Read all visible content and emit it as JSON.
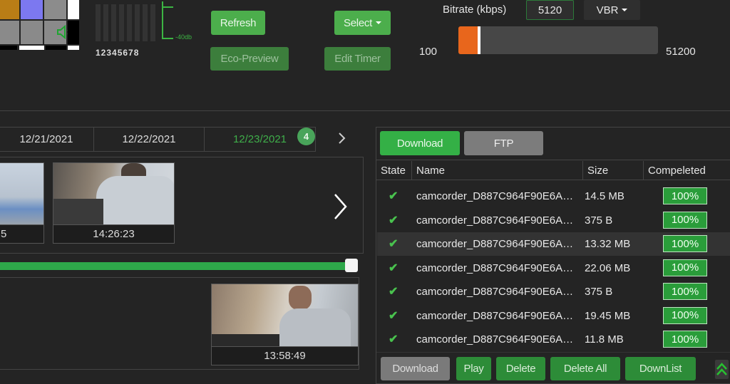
{
  "audio_meter": {
    "channels": "12345678",
    "db_label": "-40db",
    "mute_icon": "speaker-mute-icon"
  },
  "toolbar": {
    "refresh_label": "Refresh",
    "select_label": "Select",
    "eco_preview_label": "Eco-Preview",
    "edit_timer_label": "Edit Timer"
  },
  "bitrate": {
    "label": "Bitrate (kbps)",
    "value": "5120",
    "mode": "VBR",
    "min": "100",
    "max": "51200",
    "slider_fraction": 0.098,
    "accent": "#e8661c"
  },
  "date_tabs": {
    "dates": [
      "12/21/2021",
      "12/22/2021",
      "12/23/2021"
    ],
    "active_index": 2,
    "badge_count": "4",
    "next_icon": "chevron-right-icon"
  },
  "thumbnails_top": [
    {
      "time": "5"
    },
    {
      "time": "14:26:23"
    }
  ],
  "timeline": {
    "progress_fraction": 1.0,
    "color": "#2ea84a"
  },
  "thumbnails_bottom": [
    {
      "time": "13:58:49"
    }
  ],
  "transfer": {
    "tabs": [
      "Download",
      "FTP"
    ],
    "active_tab": 0,
    "columns": [
      "State",
      "Name",
      "Size",
      "Compeleted"
    ],
    "rows": [
      {
        "name": "camcorder_D887C964F90E6A…",
        "size": "14.5 MB",
        "completed": "100%"
      },
      {
        "name": "camcorder_D887C964F90E6A…",
        "size": "375 B",
        "completed": "100%"
      },
      {
        "name": "camcorder_D887C964F90E6A…",
        "size": "13.32 MB",
        "completed": "100%"
      },
      {
        "name": "camcorder_D887C964F90E6A…",
        "size": "22.06 MB",
        "completed": "100%"
      },
      {
        "name": "camcorder_D887C964F90E6A…",
        "size": "375 B",
        "completed": "100%"
      },
      {
        "name": "camcorder_D887C964F90E6A…",
        "size": "19.45 MB",
        "completed": "100%"
      },
      {
        "name": "camcorder_D887C964F90E6A…",
        "size": "11.8 MB",
        "completed": "100%"
      }
    ],
    "selected_row": 2,
    "actions": {
      "download": "Download",
      "play": "Play",
      "delete": "Delete",
      "delete_all": "Delete All",
      "downlist": "DownList"
    }
  }
}
